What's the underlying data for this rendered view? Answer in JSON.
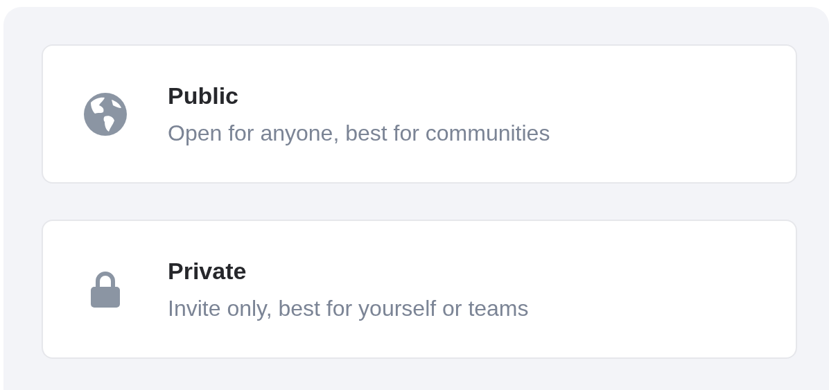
{
  "options": [
    {
      "title": "Public",
      "description": "Open for anyone, best for communities"
    },
    {
      "title": "Private",
      "description": "Invite only, best for yourself or teams"
    }
  ]
}
